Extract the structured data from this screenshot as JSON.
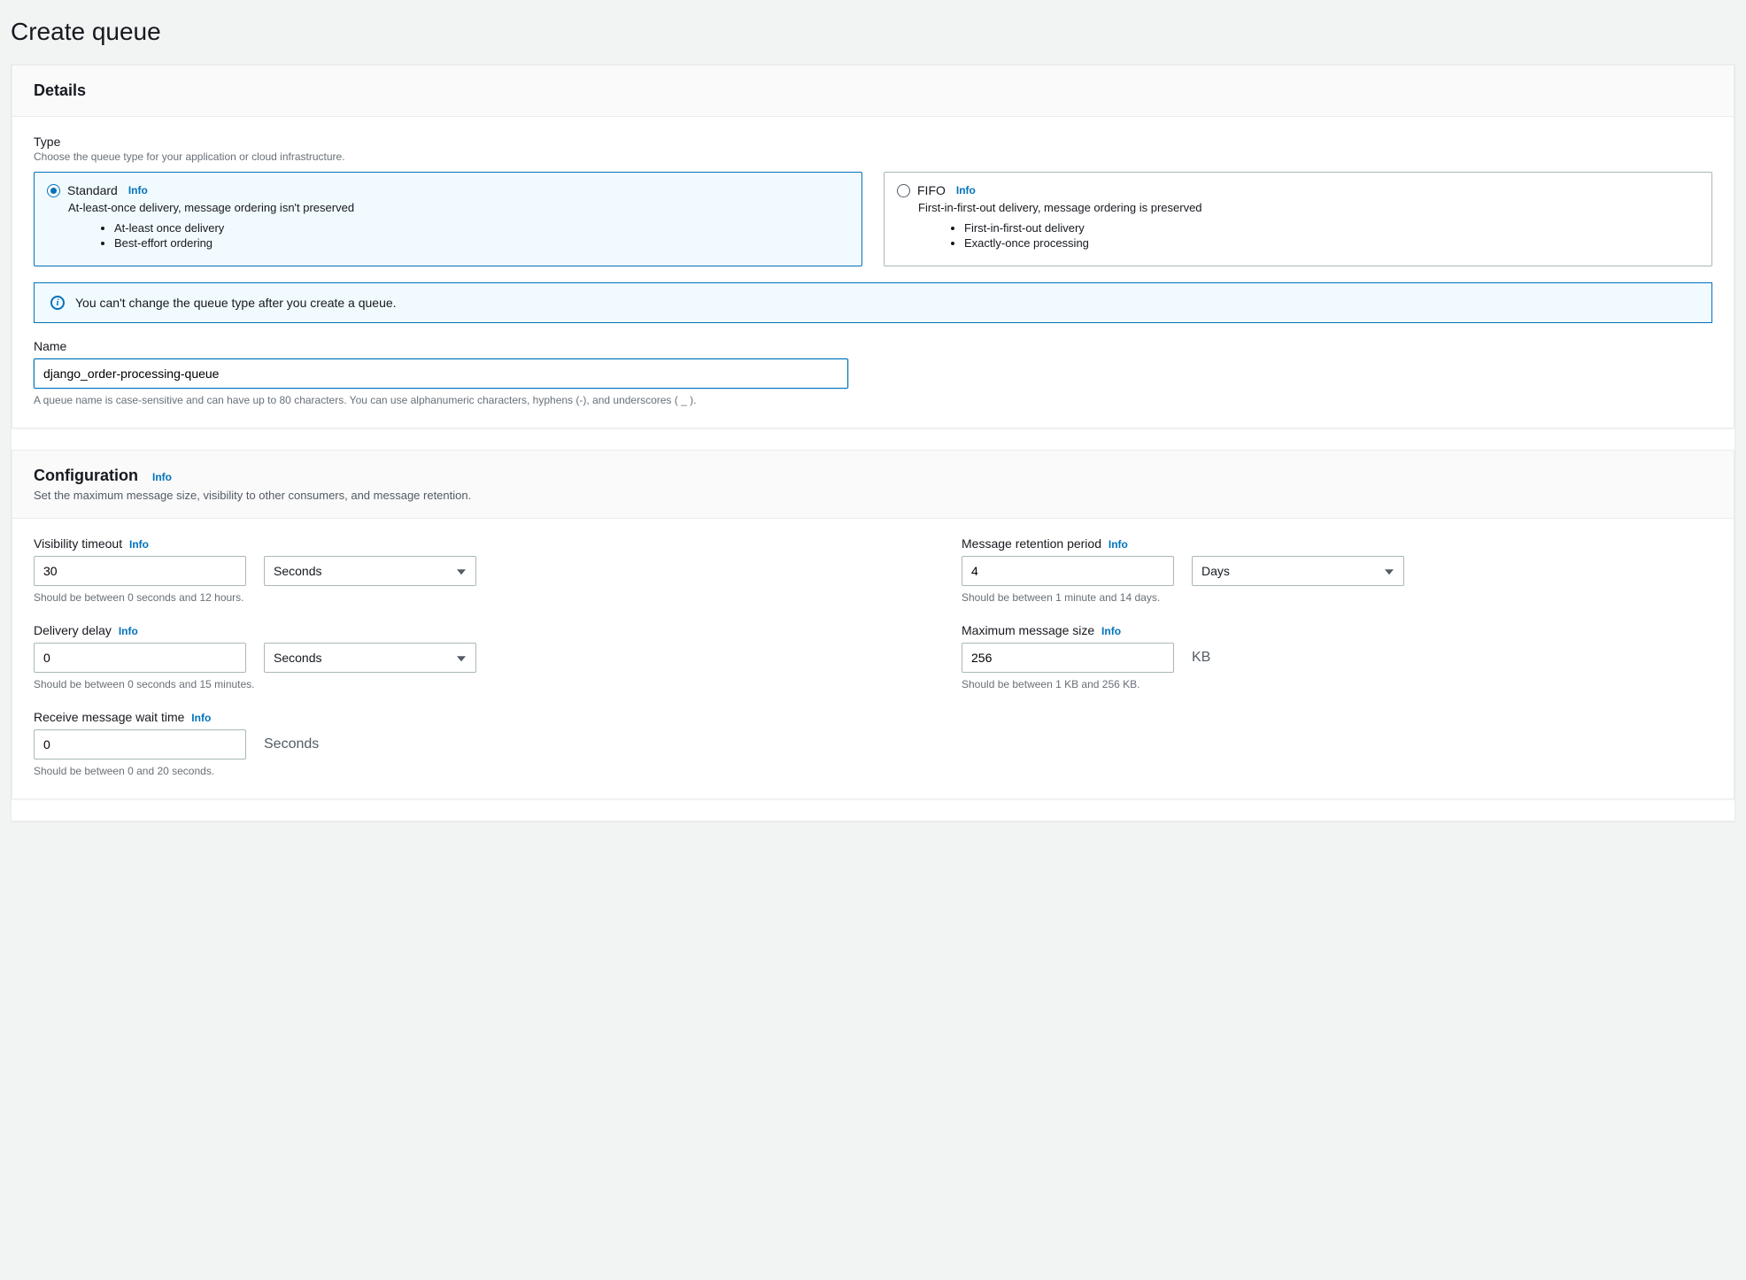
{
  "page": {
    "title": "Create queue"
  },
  "details": {
    "title": "Details",
    "type": {
      "label": "Type",
      "sub": "Choose the queue type for your application or cloud infrastructure.",
      "standard": {
        "title": "Standard",
        "info": "Info",
        "subtitle": "At-least-once delivery, message ordering isn't preserved",
        "bullet1": "At-least once delivery",
        "bullet2": "Best-effort ordering"
      },
      "fifo": {
        "title": "FIFO",
        "info": "Info",
        "subtitle": "First-in-first-out delivery, message ordering is preserved",
        "bullet1": "First-in-first-out delivery",
        "bullet2": "Exactly-once processing"
      }
    },
    "alert": "You can't change the queue type after you create a queue.",
    "name": {
      "label": "Name",
      "value": "django_order-processing-queue",
      "hint": "A queue name is case-sensitive and can have up to 80 characters. You can use alphanumeric characters, hyphens (-), and underscores ( _ )."
    }
  },
  "configuration": {
    "title": "Configuration",
    "info": "Info",
    "sub": "Set the maximum message size, visibility to other consumers, and message retention.",
    "visibility": {
      "label": "Visibility timeout",
      "info": "Info",
      "value": "30",
      "unit": "Seconds",
      "hint": "Should be between 0 seconds and 12 hours."
    },
    "retention": {
      "label": "Message retention period",
      "info": "Info",
      "value": "4",
      "unit": "Days",
      "hint": "Should be between 1 minute and 14 days."
    },
    "delay": {
      "label": "Delivery delay",
      "info": "Info",
      "value": "0",
      "unit": "Seconds",
      "hint": "Should be between 0 seconds and 15 minutes."
    },
    "maxsize": {
      "label": "Maximum message size",
      "info": "Info",
      "value": "256",
      "unit": "KB",
      "hint": "Should be between 1 KB and 256 KB."
    },
    "waittime": {
      "label": "Receive message wait time",
      "info": "Info",
      "value": "0",
      "unit": "Seconds",
      "hint": "Should be between 0 and 20 seconds."
    }
  }
}
